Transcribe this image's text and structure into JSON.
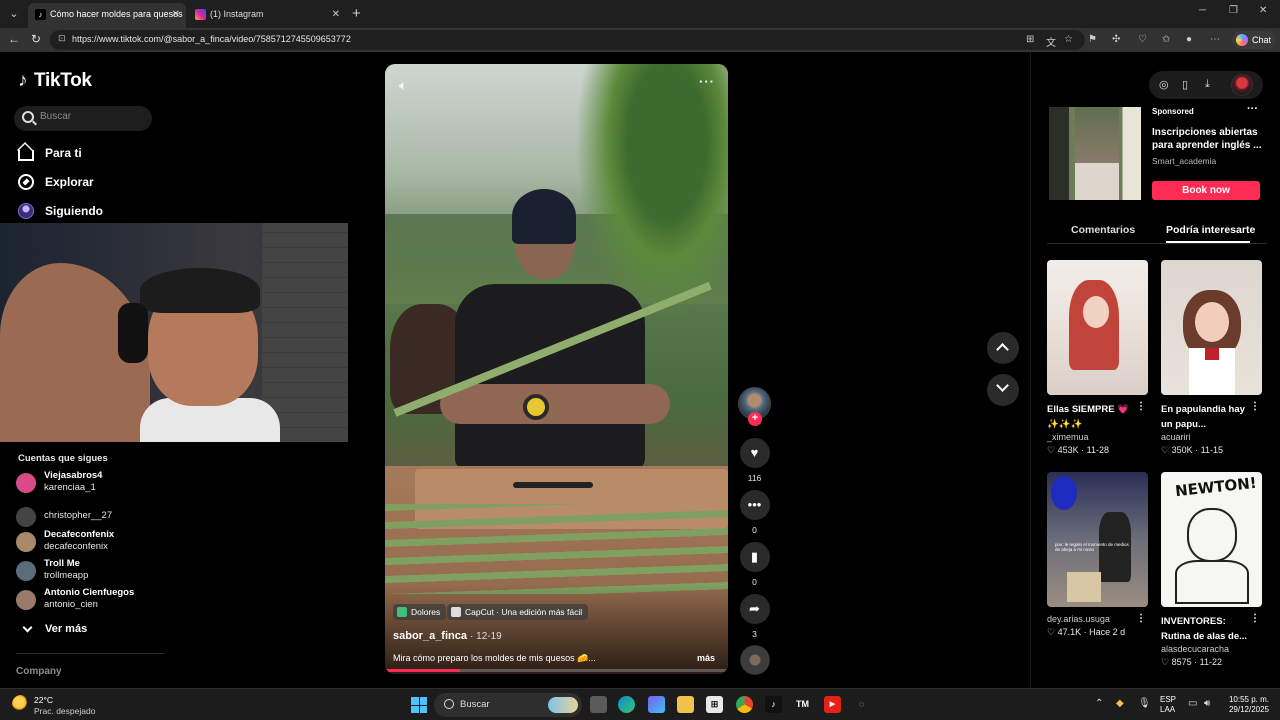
{
  "browser": {
    "tabs": [
      {
        "title": "Cómo hacer moldes para quesos",
        "active": true,
        "icon": "tiktok-icon"
      },
      {
        "title": "(1) Instagram",
        "active": false,
        "icon": "instagram-icon"
      }
    ],
    "url": "https://www.tiktok.com/@sabor_a_finca/video/7585712745509653772",
    "chat_label": "Chat"
  },
  "sidebar": {
    "logo": "TikTok",
    "search_placeholder": "Buscar",
    "nav": [
      {
        "label": "Para ti",
        "icon": "home-icon"
      },
      {
        "label": "Explorar",
        "icon": "compass-icon"
      },
      {
        "label": "Siguiendo",
        "icon": "following-icon"
      }
    ],
    "following_title": "Cuentas que sigues",
    "accounts": [
      {
        "name": "Viejasabros4",
        "handle": "karenciaa_1",
        "color": "#d94a8a"
      },
      {
        "name": "",
        "handle": "christopher__27",
        "color": "#444444"
      },
      {
        "name": "Decafeconfenix",
        "handle": "decafeconfenix",
        "color": "#a88a6a"
      },
      {
        "name": "Troll Me",
        "handle": "trollmeapp",
        "color": "#5b6b7a"
      },
      {
        "name": "Antonio Cienfuegos",
        "handle": "antonio_cien",
        "color": "#9a7a6a"
      }
    ],
    "see_more": "Ver más",
    "company": "Company"
  },
  "video": {
    "tags": [
      {
        "label": "Dolores",
        "color": "#3fbf7f"
      },
      {
        "label": "CapCut · Una edición más fácil",
        "color": "#dddddd"
      }
    ],
    "author": "sabor_a_finca",
    "date": "· 12-19",
    "caption": "Mira cómo preparo los moldes de mis quesos 🧀...",
    "caption_more": "más",
    "progress": 0.22,
    "likes": "116",
    "comments": "0",
    "saves": "0",
    "shares": "3"
  },
  "right_panel": {
    "ad": {
      "sponsored": "Sponsored",
      "title": "Inscripciones abiertas para aprender inglés ...",
      "brand": "Smart_academia",
      "button": "Book now"
    },
    "tabs": [
      "Comentarios",
      "Podría interesarte"
    ],
    "active_tab": "Podría interesarte",
    "cards": [
      {
        "title": "Ellas SIEMPRE 💗✨✨✨",
        "user": "_ximemua",
        "likes": "453K",
        "date": "11-28",
        "colors": [
          "#f0ece8",
          "#c0443a"
        ]
      },
      {
        "title": "En papulandia hay un papu...",
        "user": "acuariri",
        "likes": "350K",
        "date": "11-15",
        "colors": [
          "#e8e4e0",
          "#7a4a3a"
        ]
      },
      {
        "title": "",
        "user": "dey.arias.usuga",
        "likes": "47.1K",
        "date": "Hace 2 d",
        "colors": [
          "#1f2a6a",
          "#8c7a6a"
        ]
      },
      {
        "title": "INVENTORES: Rutina de alas de...",
        "user": "alasdecucaracha",
        "likes": "8575",
        "date": "11-22",
        "colors": [
          "#f6f6f2",
          "#222222"
        ]
      }
    ],
    "newton_text": "NEWTON!",
    "card_overlay_3": "pov: le regalo el momento de medios de abeja a mi novio"
  },
  "taskbar": {
    "temp": "22°C",
    "weather": "Prac. despejado",
    "search": "Buscar",
    "lang1": "ESP",
    "lang2": "LAA",
    "time": "10:55 p. m.",
    "date": "29/12/2025"
  },
  "colors": {
    "accent": "#fe2c55",
    "background": "#000000"
  }
}
